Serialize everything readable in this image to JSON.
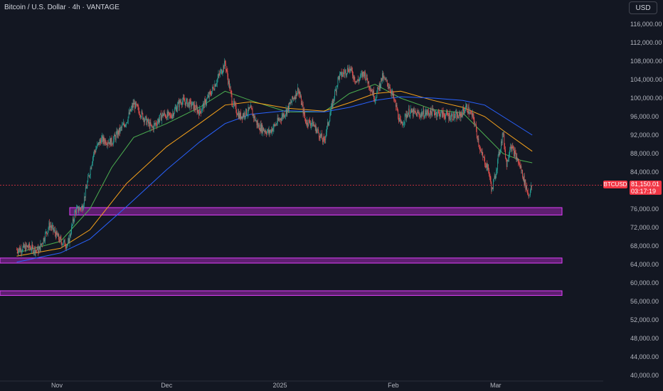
{
  "header": {
    "title": "Bitcoin / U.S. Dollar · 4h · VANTAGE",
    "currency_button": "USD"
  },
  "price_tag": {
    "symbol": "BTCUSD",
    "price": "81,150.01",
    "countdown": "03:17:19"
  },
  "colors": {
    "background": "#131722",
    "up_candle": "#26a69a",
    "down_candle": "#ef5350",
    "zone_fill": "#9c27b0",
    "zone_border": "#e040fb",
    "ema_fast": "#4caf50",
    "ema_mid": "#f7a21b",
    "ema_slow": "#2962ff",
    "price_line": "#f23645"
  },
  "chart_data": {
    "type": "candlestick",
    "title": "",
    "xlabel": "",
    "ylabel": "",
    "ylim": [
      39000,
      118500
    ],
    "y_ticks": [
      "116,000.00",
      "112,000.00",
      "108,000.00",
      "104,000.00",
      "100,000.00",
      "96,000.00",
      "92,000.00",
      "88,000.00",
      "84,000.00",
      "80,000.00",
      "76,000.00",
      "72,000.00",
      "68,000.00",
      "64,000.00",
      "60,000.00",
      "56,000.00",
      "52,000.00",
      "48,000.00",
      "44,000.00",
      "40,000.00"
    ],
    "x_ticks": [
      "Nov",
      "Dec",
      "2025",
      "Feb",
      "Mar"
    ],
    "grid": false,
    "last_price": 81150.01,
    "close_path": [
      {
        "x": "Oct 21",
        "y": 67200
      },
      {
        "x": "Oct 24",
        "y": 67800
      },
      {
        "x": "Oct 27",
        "y": 67000
      },
      {
        "x": "Oct 30",
        "y": 72600
      },
      {
        "x": "Nov 2",
        "y": 69000
      },
      {
        "x": "Nov 4",
        "y": 68200
      },
      {
        "x": "Nov 6",
        "y": 75500
      },
      {
        "x": "Nov 8",
        "y": 76500
      },
      {
        "x": "Nov 11",
        "y": 88000
      },
      {
        "x": "Nov 13",
        "y": 91000
      },
      {
        "x": "Nov 16",
        "y": 90500
      },
      {
        "x": "Nov 20",
        "y": 95000
      },
      {
        "x": "Nov 22",
        "y": 98800
      },
      {
        "x": "Nov 25",
        "y": 95500
      },
      {
        "x": "Nov 27",
        "y": 93500
      },
      {
        "x": "Nov 30",
        "y": 96500
      },
      {
        "x": "Dec 2",
        "y": 96000
      },
      {
        "x": "Dec 5",
        "y": 99500
      },
      {
        "x": "Dec 8",
        "y": 98500
      },
      {
        "x": "Dec 10",
        "y": 97000
      },
      {
        "x": "Dec 13",
        "y": 101000
      },
      {
        "x": "Dec 16",
        "y": 106000
      },
      {
        "x": "Dec 17",
        "y": 107500
      },
      {
        "x": "Dec 19",
        "y": 99000
      },
      {
        "x": "Dec 21",
        "y": 96000
      },
      {
        "x": "Dec 24",
        "y": 97500
      },
      {
        "x": "Dec 26",
        "y": 94000
      },
      {
        "x": "Dec 29",
        "y": 92500
      },
      {
        "x": "Dec 31",
        "y": 94500
      },
      {
        "x": "Jan 3",
        "y": 97500
      },
      {
        "x": "Jan 6",
        "y": 102000
      },
      {
        "x": "Jan 8",
        "y": 95000
      },
      {
        "x": "Jan 10",
        "y": 94500
      },
      {
        "x": "Jan 13",
        "y": 90500
      },
      {
        "x": "Jan 15",
        "y": 97500
      },
      {
        "x": "Jan 17",
        "y": 104500
      },
      {
        "x": "Jan 20",
        "y": 106500
      },
      {
        "x": "Jan 22",
        "y": 103500
      },
      {
        "x": "Jan 24",
        "y": 105500
      },
      {
        "x": "Jan 27",
        "y": 100000
      },
      {
        "x": "Jan 29",
        "y": 104500
      },
      {
        "x": "Jan 31",
        "y": 102500
      },
      {
        "x": "Feb 2",
        "y": 97500
      },
      {
        "x": "Feb 3",
        "y": 94000
      },
      {
        "x": "Feb 5",
        "y": 97000
      },
      {
        "x": "Feb 8",
        "y": 96500
      },
      {
        "x": "Feb 12",
        "y": 97000
      },
      {
        "x": "Feb 16",
        "y": 96200
      },
      {
        "x": "Feb 19",
        "y": 96000
      },
      {
        "x": "Feb 21",
        "y": 98000
      },
      {
        "x": "Feb 23",
        "y": 95500
      },
      {
        "x": "Feb 25",
        "y": 88000
      },
      {
        "x": "Feb 27",
        "y": 84500
      },
      {
        "x": "Feb 28",
        "y": 80000
      },
      {
        "x": "Mar 1",
        "y": 84000
      },
      {
        "x": "Mar 3",
        "y": 92500
      },
      {
        "x": "Mar 4",
        "y": 85500
      },
      {
        "x": "Mar 5",
        "y": 90000
      },
      {
        "x": "Mar 7",
        "y": 86500
      },
      {
        "x": "Mar 8",
        "y": 84500
      },
      {
        "x": "Mar 9",
        "y": 81500
      },
      {
        "x": "Mar 10",
        "y": 79000
      },
      {
        "x": "Mar 11",
        "y": 81150
      }
    ],
    "moving_averages": [
      {
        "name": "",
        "color": "#4caf50",
        "values": [
          {
            "x": "Oct 21",
            "y": 66500
          },
          {
            "x": "Nov 2",
            "y": 69000
          },
          {
            "x": "Nov 10",
            "y": 76000
          },
          {
            "x": "Nov 16",
            "y": 85000
          },
          {
            "x": "Nov 22",
            "y": 91500
          },
          {
            "x": "Dec 1",
            "y": 94500
          },
          {
            "x": "Dec 10",
            "y": 98000
          },
          {
            "x": "Dec 17",
            "y": 101500
          },
          {
            "x": "Dec 24",
            "y": 99500
          },
          {
            "x": "Jan 3",
            "y": 97000
          },
          {
            "x": "Jan 13",
            "y": 97000
          },
          {
            "x": "Jan 20",
            "y": 101000
          },
          {
            "x": "Jan 27",
            "y": 103000
          },
          {
            "x": "Feb 3",
            "y": 100000
          },
          {
            "x": "Feb 12",
            "y": 97500
          },
          {
            "x": "Feb 20",
            "y": 96800
          },
          {
            "x": "Feb 26",
            "y": 92000
          },
          {
            "x": "Mar 3",
            "y": 88000
          },
          {
            "x": "Mar 8",
            "y": 86500
          },
          {
            "x": "Mar 11",
            "y": 86000
          }
        ]
      },
      {
        "name": "",
        "color": "#f7a21b",
        "values": [
          {
            "x": "Oct 21",
            "y": 65800
          },
          {
            "x": "Nov 2",
            "y": 67500
          },
          {
            "x": "Nov 10",
            "y": 71500
          },
          {
            "x": "Nov 20",
            "y": 81500
          },
          {
            "x": "Dec 1",
            "y": 89500
          },
          {
            "x": "Dec 10",
            "y": 94500
          },
          {
            "x": "Dec 17",
            "y": 98500
          },
          {
            "x": "Dec 24",
            "y": 99200
          },
          {
            "x": "Jan 3",
            "y": 97800
          },
          {
            "x": "Jan 13",
            "y": 97200
          },
          {
            "x": "Jan 20",
            "y": 99000
          },
          {
            "x": "Jan 27",
            "y": 101000
          },
          {
            "x": "Feb 3",
            "y": 101500
          },
          {
            "x": "Feb 12",
            "y": 99500
          },
          {
            "x": "Feb 20",
            "y": 98000
          },
          {
            "x": "Feb 26",
            "y": 96000
          },
          {
            "x": "Mar 3",
            "y": 93000
          },
          {
            "x": "Mar 11",
            "y": 88500
          }
        ]
      },
      {
        "name": "",
        "color": "#2962ff",
        "values": [
          {
            "x": "Oct 21",
            "y": 64500
          },
          {
            "x": "Nov 2",
            "y": 66500
          },
          {
            "x": "Nov 10",
            "y": 69500
          },
          {
            "x": "Nov 20",
            "y": 76500
          },
          {
            "x": "Dec 1",
            "y": 84500
          },
          {
            "x": "Dec 10",
            "y": 90500
          },
          {
            "x": "Dec 17",
            "y": 94500
          },
          {
            "x": "Dec 24",
            "y": 96500
          },
          {
            "x": "Jan 3",
            "y": 97300
          },
          {
            "x": "Jan 13",
            "y": 97000
          },
          {
            "x": "Jan 20",
            "y": 98000
          },
          {
            "x": "Jan 27",
            "y": 99500
          },
          {
            "x": "Feb 3",
            "y": 100300
          },
          {
            "x": "Feb 12",
            "y": 100000
          },
          {
            "x": "Feb 20",
            "y": 99500
          },
          {
            "x": "Feb 26",
            "y": 98500
          },
          {
            "x": "Mar 3",
            "y": 96000
          },
          {
            "x": "Mar 11",
            "y": 92000
          }
        ]
      }
    ],
    "support_zones": [
      {
        "y_low": 74700,
        "y_high": 76300
      },
      {
        "y_low": 64300,
        "y_high": 65400
      },
      {
        "y_low": 57300,
        "y_high": 58300
      }
    ]
  }
}
